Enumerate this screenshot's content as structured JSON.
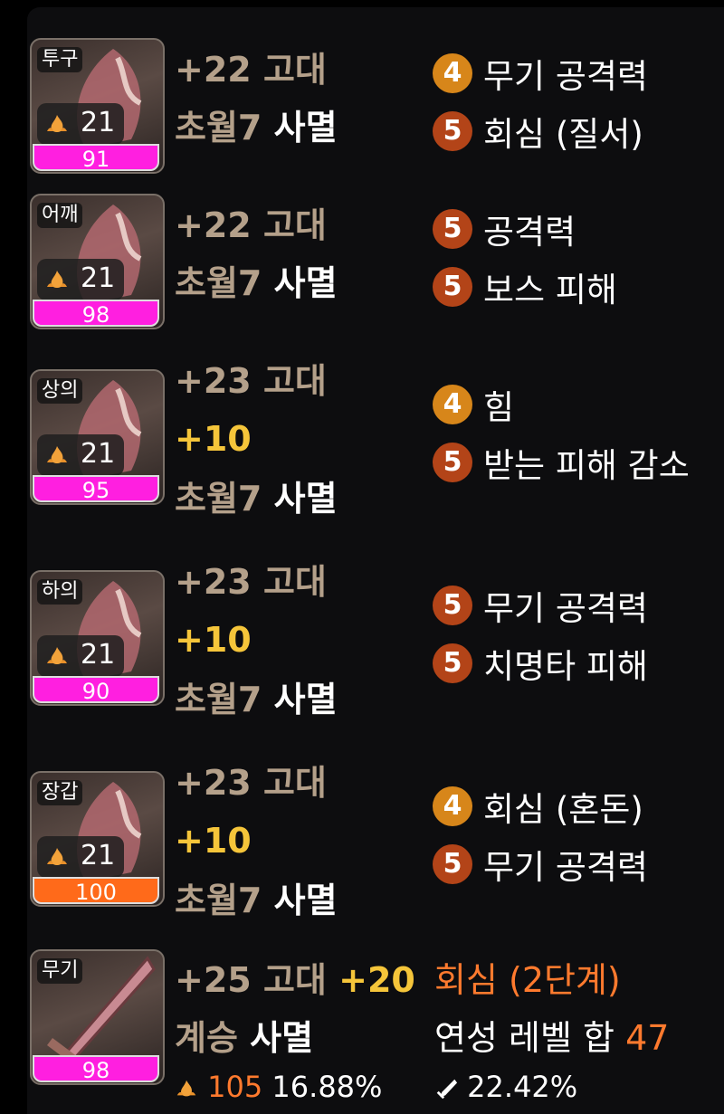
{
  "items": [
    {
      "slot": "투구",
      "level": "21",
      "quality": "91",
      "qcolor": "pink",
      "upgrade": "+22 고대",
      "extra": "",
      "set_prefix": "초월7",
      "set_name": "사멸",
      "options": [
        {
          "badge": "4",
          "text": "무기 공격력"
        },
        {
          "badge": "5",
          "text": "회심 (질서)"
        }
      ]
    },
    {
      "slot": "어깨",
      "level": "21",
      "quality": "98",
      "qcolor": "pink",
      "upgrade": "+22 고대",
      "extra": "",
      "set_prefix": "초월7",
      "set_name": "사멸",
      "options": [
        {
          "badge": "5",
          "text": "공격력"
        },
        {
          "badge": "5",
          "text": "보스 피해"
        }
      ]
    },
    {
      "slot": "상의",
      "level": "21",
      "quality": "95",
      "qcolor": "pink",
      "upgrade": "+23 고대",
      "extra": "+10",
      "set_prefix": "초월7",
      "set_name": "사멸",
      "options": [
        {
          "badge": "4",
          "text": "힘"
        },
        {
          "badge": "5",
          "text": "받는 피해 감소"
        }
      ]
    },
    {
      "slot": "하의",
      "level": "21",
      "quality": "90",
      "qcolor": "pink",
      "upgrade": "+23 고대",
      "extra": "+10",
      "set_prefix": "초월7",
      "set_name": "사멸",
      "options": [
        {
          "badge": "5",
          "text": "무기 공격력"
        },
        {
          "badge": "5",
          "text": "치명타 피해"
        }
      ]
    },
    {
      "slot": "장갑",
      "level": "21",
      "quality": "100",
      "qcolor": "orange",
      "upgrade": "+23 고대",
      "extra": "+10",
      "set_prefix": "초월7",
      "set_name": "사멸",
      "options": [
        {
          "badge": "4",
          "text": "회심 (혼돈)"
        },
        {
          "badge": "5",
          "text": "무기 공격력"
        }
      ]
    }
  ],
  "weapon": {
    "slot": "무기",
    "quality": "98",
    "upgrade": "+25 고대",
    "extra": "+20",
    "set_prefix": "계승",
    "set_name": "사멸",
    "effect": "회심 (2단계)",
    "refine_label": "연성 레벨 합",
    "refine_value": "47",
    "flame_value": "105",
    "flame_percent": "16.88%",
    "sword_percent": "22.42%"
  },
  "colors": {
    "pink": "#ff1fe0",
    "orange": "#ff6a1a",
    "gold": "#f5c53a",
    "tan": "#b4a08a",
    "badge4": "#d7861a",
    "badge5": "#b34418"
  }
}
